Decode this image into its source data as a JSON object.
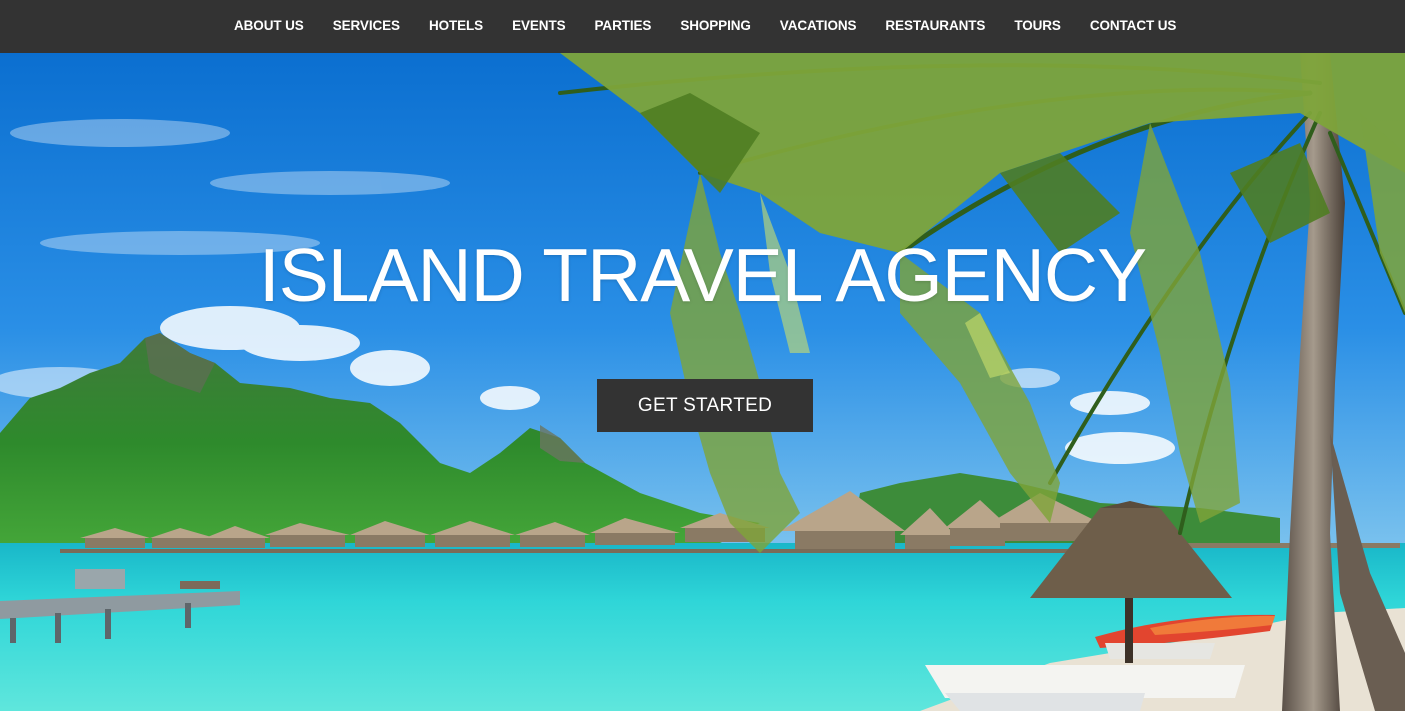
{
  "nav": {
    "items": [
      {
        "label": "ABOUT US"
      },
      {
        "label": "SERVICES"
      },
      {
        "label": "HOTELS"
      },
      {
        "label": "EVENTS"
      },
      {
        "label": "PARTIES"
      },
      {
        "label": "SHOPPING"
      },
      {
        "label": "VACATIONS"
      },
      {
        "label": "RESTAURANTS"
      },
      {
        "label": "TOURS"
      },
      {
        "label": "CONTACT US"
      }
    ]
  },
  "hero": {
    "title": "ISLAND TRAVEL AGENCY",
    "cta_label": "GET STARTED",
    "background_scene": "tropical-beach-photo"
  },
  "colors": {
    "nav_bg": "#333333",
    "button_bg": "#333333",
    "text": "#ffffff",
    "sky": "#1d7fd6",
    "lagoon": "#2fd3d6"
  }
}
